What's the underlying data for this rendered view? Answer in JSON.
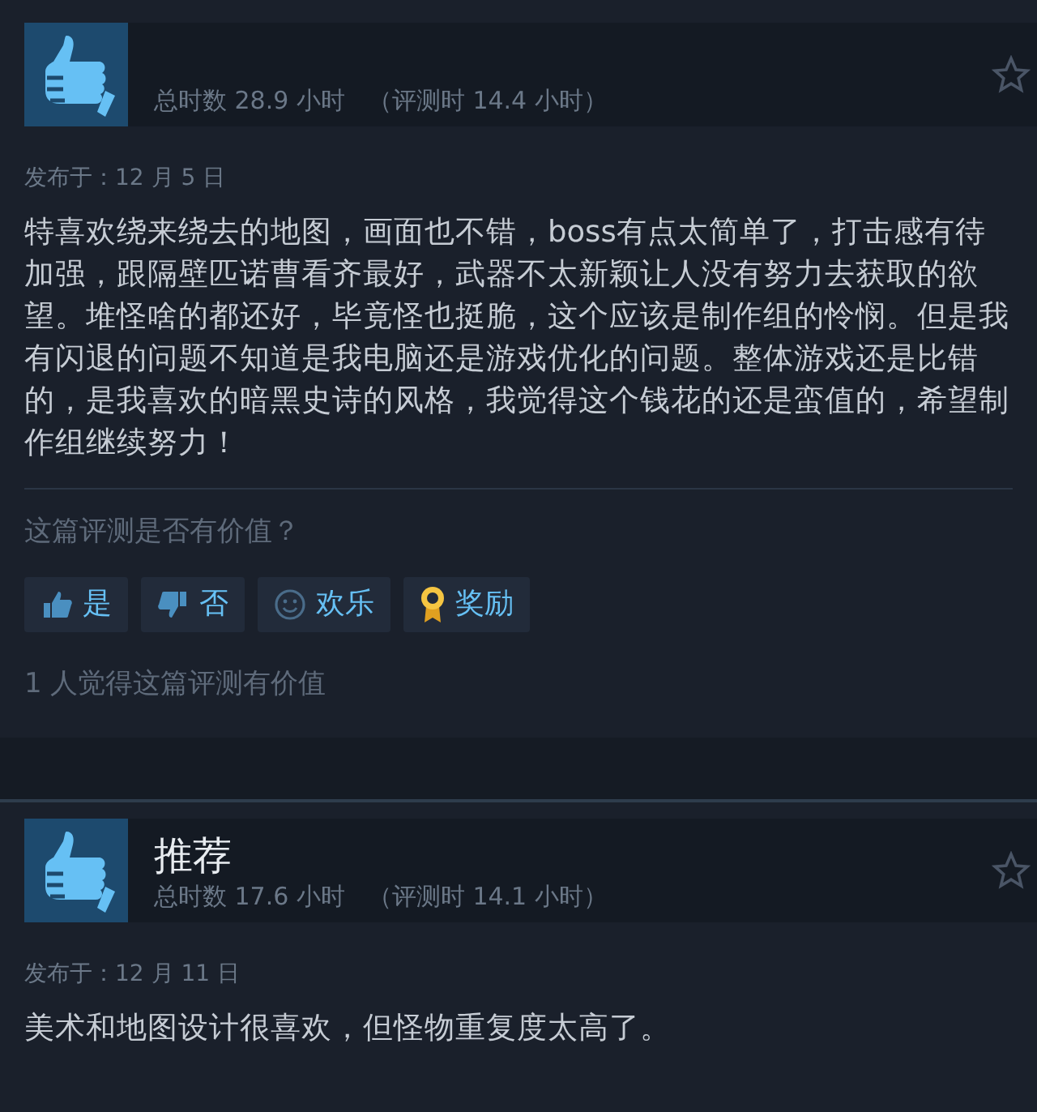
{
  "reviews": [
    {
      "recommended": true,
      "hours": "总时数 28.9 小时",
      "review_hours": "（评测时 14.4 小时）",
      "posted": "发布于：12 月 5 日",
      "body": "特喜欢绕来绕去的地图，画面也不错，boss有点太简单了，打击感有待加强，跟隔壁匹诺曹看齐最好，武器不太新颖让人没有努力去获取的欲望。堆怪啥的都还好，毕竟怪也挺脆，这个应该是制作组的怜悯。但是我有闪退的问题不知道是我电脑还是游戏优化的问题。整体游戏还是比错的，是我喜欢的暗黑史诗的风格，我觉得这个钱花的还是蛮值的，希望制作组继续努力！",
      "helpful_prompt": "这篇评测是否有价值？",
      "buttons": [
        {
          "kind": "yes",
          "label": "是"
        },
        {
          "kind": "no",
          "label": "否"
        },
        {
          "kind": "funny",
          "label": "欢乐"
        },
        {
          "kind": "award",
          "label": "奖励"
        }
      ],
      "helpful_count": "1 人觉得这篇评测有价值"
    },
    {
      "recommended": true,
      "title": "推荐",
      "hours": "总时数 17.6 小时",
      "review_hours": "（评测时 14.1 小时）",
      "posted": "发布于：12 月 11 日",
      "body": "美术和地图设计很喜欢，但怪物重复度太高了。"
    }
  ]
}
